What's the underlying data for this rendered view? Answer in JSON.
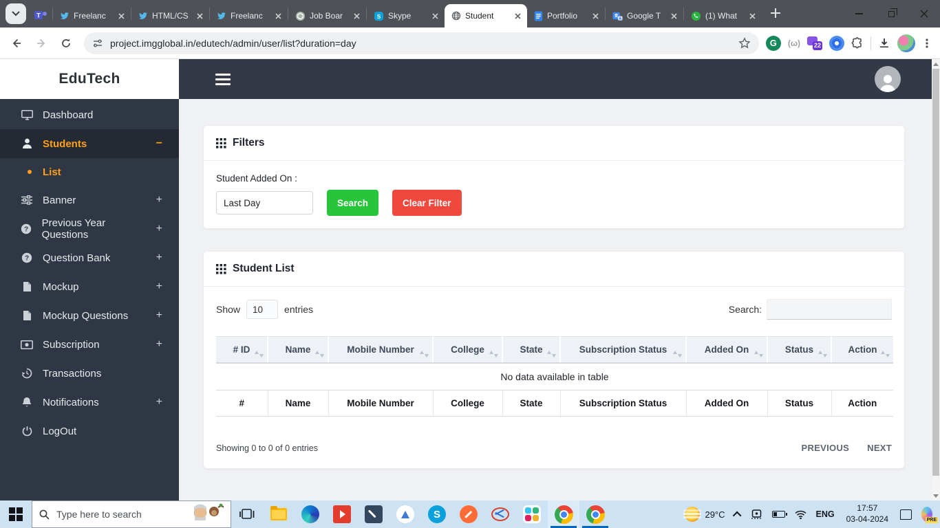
{
  "browser": {
    "tabs": [
      {
        "label": "Freelanc",
        "icon": "twitter"
      },
      {
        "label": "HTML/CS",
        "icon": "twitter"
      },
      {
        "label": "Freelanc",
        "icon": "twitter"
      },
      {
        "label": "Job Boar",
        "icon": "chatgpt"
      },
      {
        "label": "Skype",
        "icon": "skype"
      },
      {
        "label": "Student",
        "icon": "globe",
        "active": true
      },
      {
        "label": "Portfolio",
        "icon": "docs"
      },
      {
        "label": "Google T",
        "icon": "translate"
      },
      {
        "label": "(1) What",
        "icon": "whatsapp"
      }
    ],
    "url": "project.imgglobal.in/edutech/admin/user/list?duration=day",
    "extensions_badge": "22",
    "grammarly_letter": "G",
    "gray_ext_label": "(ω)",
    "teams_letter": "T",
    "skype_letter": "S"
  },
  "sidebar": {
    "logo": "EduTech",
    "items": [
      {
        "label": "Dashboard"
      },
      {
        "label": "Students",
        "toggle": "−"
      },
      {
        "label": "List"
      },
      {
        "label": "Banner",
        "toggle": "+"
      },
      {
        "label": "Previous Year Questions",
        "toggle": "+"
      },
      {
        "label": "Question Bank",
        "toggle": "+"
      },
      {
        "label": "Mockup",
        "toggle": "+"
      },
      {
        "label": "Mockup Questions",
        "toggle": "+"
      },
      {
        "label": "Subscription",
        "toggle": "+"
      },
      {
        "label": "Transactions"
      },
      {
        "label": "Notifications",
        "toggle": "+"
      },
      {
        "label": "LogOut"
      }
    ]
  },
  "filters": {
    "title": "Filters",
    "label": "Student Added On :",
    "value": "Last Day",
    "search_label": "Search",
    "clear_label": "Clear Filter"
  },
  "student_list": {
    "title": "Student List",
    "show_label": "Show",
    "entries_value": "10",
    "entries_label": "entries",
    "search_label": "Search:",
    "columns": [
      "# ID",
      "Name",
      "Mobile Number",
      "College",
      "State",
      "Subscription Status",
      "Added On",
      "Status",
      "Action"
    ],
    "footer_columns": [
      "#",
      "Name",
      "Mobile Number",
      "College",
      "State",
      "Subscription Status",
      "Added On",
      "Status",
      "Action"
    ],
    "empty_text": "No data available in table",
    "info_text": "Showing 0 to 0 of 0 entries",
    "prev_label": "PREVIOUS",
    "next_label": "NEXT"
  },
  "taskbar": {
    "search_placeholder": "Type here to search",
    "weather_temp": "29°C",
    "language": "ENG",
    "time": "17:57",
    "date": "03-04-2024",
    "copilot_badge": "PRE"
  },
  "colors": {
    "accent_orange": "#ff9f1a",
    "button_green": "#26c53a",
    "button_red": "#ef483d",
    "sidebar_bg": "#2f3744",
    "topbar_bg": "#333a46",
    "taskbar_bg": "#cde3f3"
  }
}
